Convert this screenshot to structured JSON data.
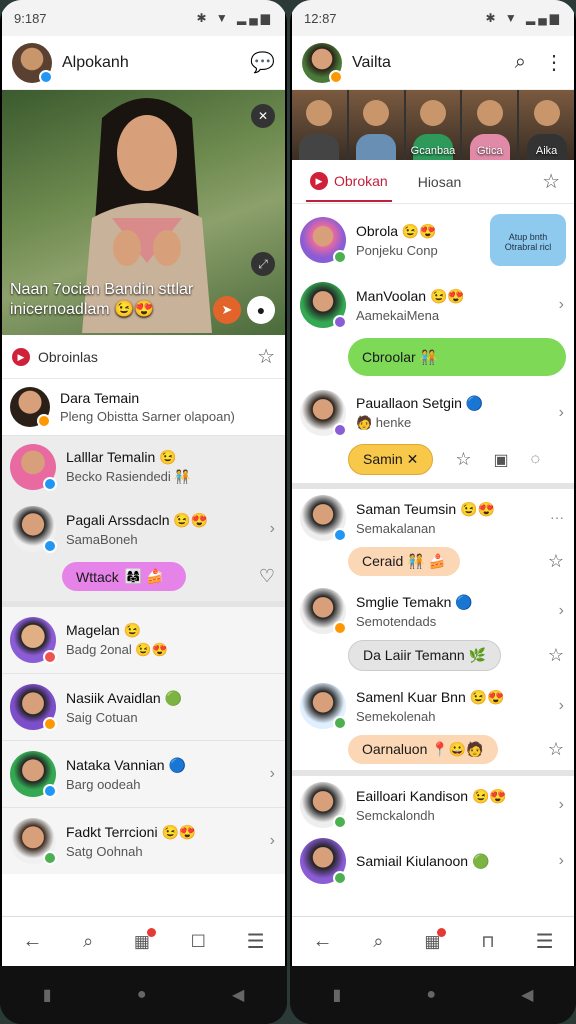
{
  "left": {
    "status": {
      "time": "9:187",
      "icons": "✱ ▼ ▂▄▆"
    },
    "appbar": {
      "title": "Alpokanh"
    },
    "hero": {
      "caption_line1": "Naan 7ocian Bandin sttlar",
      "caption_line2": "inicernoadlam 😉😍"
    },
    "tabrow": {
      "label": "Obroinlas"
    },
    "featured": {
      "name": "Dara Temain",
      "sub": "Pleng Obistta Sarner olapoan)"
    },
    "rows": [
      {
        "name": "Lalllar Temalin 😉",
        "sub": "Becko Rasiendedi 🧑‍🤝‍🧑",
        "color": "#e86aa0",
        "badge": "#2196f3"
      },
      {
        "name": "Pagali Arssdacln 😉😍",
        "sub": "SamaBoneh",
        "color": "#f0f0f0",
        "badge": "#2196f3"
      }
    ],
    "pill": {
      "label": "Wttack",
      "icons": "👩‍👩‍👧 🍰"
    },
    "rows2": [
      {
        "name": "Magelan 😉",
        "sub": "Badg 2onal 😉😍",
        "color": "#8a5cd6",
        "badge": "#ef5350"
      },
      {
        "name": "Nasiik Avaidlan 🟢",
        "sub": "Saig Cotuan",
        "color": "#7d4ec9",
        "badge": "#ff9800"
      },
      {
        "name": "Nataka Vannian 🔵",
        "sub": "Barg oodeah",
        "color": "#34a853",
        "badge": "#2196f3"
      },
      {
        "name": "Fadkt Terrcioni 😉😍",
        "sub": "Satg Oohnah",
        "color": "#f0f0f0",
        "badge": "#4caf50"
      }
    ]
  },
  "right": {
    "status": {
      "time": "12:87",
      "icons": "✱ ▼ ▂▄▆"
    },
    "appbar": {
      "title": "Vailta"
    },
    "strip": [
      {
        "label": ""
      },
      {
        "label": ""
      },
      {
        "label": "Gcanbaa"
      },
      {
        "label": "Gtica"
      },
      {
        "label": "Aika"
      }
    ],
    "tabs": {
      "active": "Obrokan",
      "other": "Hiosan"
    },
    "first": {
      "name": "Obrola 😉😍",
      "sub": "Ponjeku Conp",
      "action": "Atup bnth\nOtrabral ricl"
    },
    "manvoolan": {
      "name": "ManVoolan 😉😍",
      "sub": "AamekaiMena"
    },
    "cbroolar": {
      "label": "Cbroolar 🧑‍🤝‍🧑"
    },
    "paualla": {
      "name": "Paualla​on Setgin 🔵",
      "sub": "🧑 henke"
    },
    "samin": {
      "label": "Samin ✕"
    },
    "list": [
      {
        "name": "Saman Teumsin 😉😍",
        "sub": "Semakalanan",
        "color": "#eee",
        "badge": "#2196f3",
        "pill": "Ceraid 🧑‍🤝‍🧑 🍰",
        "pillcolor": "#fbd7b5"
      },
      {
        "name": "Smglie Temakn 🔵",
        "sub": "Semotendads",
        "color": "#eee",
        "badge": "#ff9800",
        "pill": "Da Laiir Temann 🌿",
        "pillcolor": "#e4e4e4"
      },
      {
        "name": "Samenl Kuar Bnn 😉😍",
        "sub": "Semekolenah",
        "color": "#e0f0ff",
        "badge": "#4caf50",
        "pill": "Oarnaluon 📍😀🧑",
        "pillcolor": "#fbd7b5"
      },
      {
        "name": "Eailloari Kandison 😉😍",
        "sub": "Semckalondh",
        "color": "#eee",
        "badge": "#4caf50",
        "pill": "",
        "pillcolor": ""
      },
      {
        "name": "Samiail Kiulanoon 🟢",
        "sub": "",
        "color": "#8a5cd6",
        "badge": "#4caf50",
        "pill": "",
        "pillcolor": ""
      }
    ]
  },
  "nav": {
    "back": "←",
    "search": "🔍",
    "store": "🛍",
    "profile": "👤",
    "menu": "☰"
  },
  "colors": {
    "accent": "#c21f3a",
    "green_pill": "#7ed957",
    "purple_pill": "#e683e8",
    "yellow_pill": "#f7c84a",
    "blue_button": "#8ec9ee"
  }
}
